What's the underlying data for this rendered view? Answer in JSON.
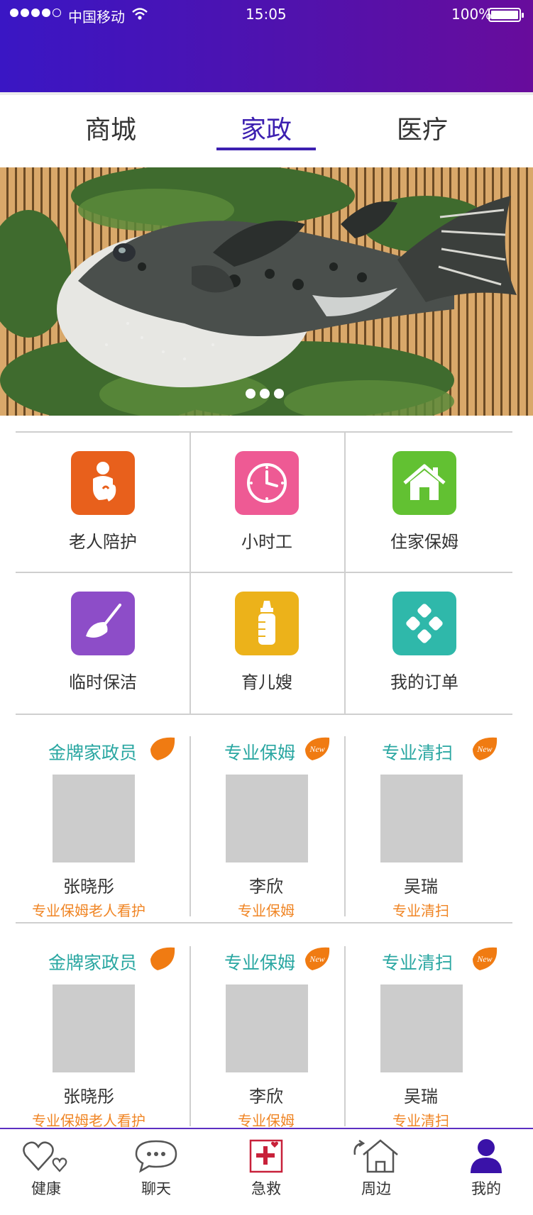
{
  "status_bar": {
    "carrier": "中国移动",
    "time": "15:05",
    "battery": "100%"
  },
  "tabs": [
    {
      "label": "商城",
      "active": false
    },
    {
      "label": "家政",
      "active": true
    },
    {
      "label": "医疗",
      "active": false
    }
  ],
  "banner": {
    "page_count": 3,
    "current_page": 1
  },
  "services": [
    {
      "label": "老人陪护",
      "icon": "elderly-care-icon",
      "color": "#e8601c"
    },
    {
      "label": "小时工",
      "icon": "clock-icon",
      "color": "#ee5a94"
    },
    {
      "label": "住家保姆",
      "icon": "home-icon",
      "color": "#62c132"
    },
    {
      "label": "临时保洁",
      "icon": "broom-icon",
      "color": "#8d4dc8"
    },
    {
      "label": "育儿嫂",
      "icon": "baby-bottle-icon",
      "color": "#ecb21a"
    },
    {
      "label": "我的订单",
      "icon": "order-icon",
      "color": "#2fb8aa"
    }
  ],
  "staff_rows": [
    [
      {
        "title": "金牌家政员",
        "badge": "",
        "name": "张晓彤",
        "role": "专业保姆老人看护"
      },
      {
        "title": "专业保姆",
        "badge": "New",
        "name": "李欣",
        "role": "专业保姆"
      },
      {
        "title": "专业清扫",
        "badge": "New",
        "name": "吴瑞",
        "role": "专业清扫"
      }
    ],
    [
      {
        "title": "金牌家政员",
        "badge": "",
        "name": "张晓彤",
        "role": "专业保姆老人看护"
      },
      {
        "title": "专业保姆",
        "badge": "New",
        "name": "李欣",
        "role": "专业保姆"
      },
      {
        "title": "专业清扫",
        "badge": "New",
        "name": "吴瑞",
        "role": "专业清扫"
      }
    ]
  ],
  "bottom_nav": [
    {
      "label": "健康",
      "icon": "hearts-icon"
    },
    {
      "label": "聊天",
      "icon": "chat-bubble-icon"
    },
    {
      "label": "急救",
      "icon": "first-aid-icon"
    },
    {
      "label": "周边",
      "icon": "nearby-home-icon"
    },
    {
      "label": "我的",
      "icon": "user-icon",
      "active": true
    }
  ],
  "colors": {
    "header_gradient_start": "#3a16c4",
    "header_gradient_end": "#680c9c",
    "accent": "#3c1fb0",
    "teal_title": "#2aa7a2",
    "orange_role": "#f08524",
    "badge_orange": "#f07b12"
  }
}
